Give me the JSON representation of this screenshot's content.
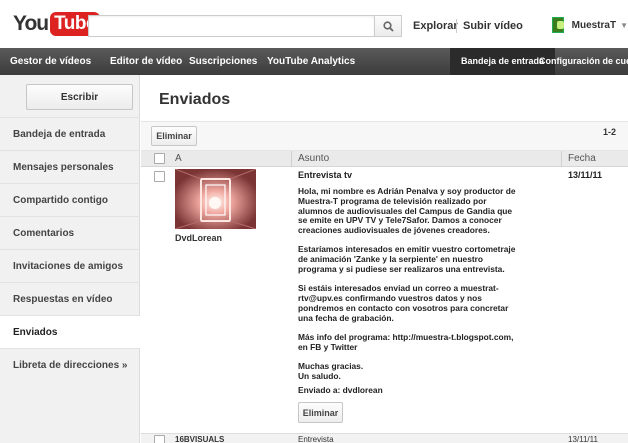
{
  "masthead": {
    "logo_you": "You",
    "logo_tube": "Tube",
    "search_placeholder": "",
    "explore": "Explorar",
    "upload": "Subir vídeo",
    "user": "MuestraT"
  },
  "topnav": {
    "items": [
      "Gestor de vídeos",
      "Editor de vídeo",
      "Suscripciones",
      "YouTube Analytics"
    ],
    "inbox": "Bandeja de entrada",
    "account": "Configuración de cuenta"
  },
  "sidebar": {
    "write_button": "Escribir",
    "items": [
      "Bandeja de entrada",
      "Mensajes personales",
      "Compartido contigo",
      "Comentarios",
      "Invitaciones de amigos",
      "Respuestas en vídeo",
      "Enviados",
      "Libreta de direcciones »"
    ],
    "active_index": 6
  },
  "main": {
    "title": "Enviados",
    "delete_button": "Eliminar",
    "pager": "1-2",
    "columns": {
      "from": "A",
      "subject": "Asunto",
      "date": "Fecha"
    }
  },
  "message": {
    "sender": "DvdLorean",
    "subject": "Entrevista tv",
    "date": "13/11/11",
    "paragraphs": [
      "Hola, mi nombre es Adrián Penalva y soy productor de Muestra-T programa de televisión realizado por alumnos de audiovisuales del Campus de Gandia que se emite en UPV TV y Tele7Safor. Damos a conocer creaciones audiovisuales de jóvenes creadores.",
      "Estaríamos interesados en emitir vuestro cortometraje de animación 'Zanke y la serpiente' en nuestro programa y si pudiese ser realizaros una entrevista.",
      "Si estáis interesados enviad un correo a muestrat-rtv@upv.es confirmando vuestros datos y nos pondremos en contacto con vosotros para concretar una fecha de grabación.",
      "Más info del programa: http://muestra-t.blogspot.com, en FB y Twitter",
      "Muchas gracias.\nUn saludo."
    ],
    "sent_to": "Enviado a: dvdlorean",
    "delete_button": "Eliminar"
  },
  "next_message": {
    "sender": "16BVISUALS",
    "subject": "Entrevista",
    "date": "13/11/11"
  },
  "colors": {
    "logo_red": "#dd2222",
    "topbar": "#444444",
    "sidebar_bg": "#f1f1f1"
  }
}
